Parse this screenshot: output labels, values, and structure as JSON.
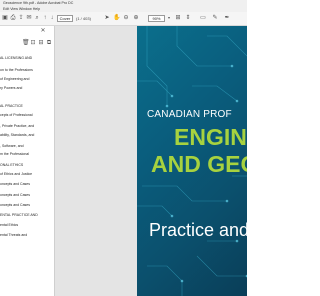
{
  "window": {
    "title": "Geoscience 9th.pdf - Adobe Acrobat Pro DC"
  },
  "menubar": {
    "text": "Edit  View  Window  Help"
  },
  "toolbar": {
    "page_input": "Cover",
    "page_count": "(1 / 403)",
    "zoom": "90%",
    "icons": [
      "save-icon",
      "print-icon",
      "upload-icon",
      "email-icon",
      "search-icon",
      "prev-page-icon",
      "next-page-icon",
      "select-icon",
      "hand-icon",
      "zoom-out-icon",
      "zoom-in-icon",
      "zoom-dropdown-icon",
      "fit-page-icon",
      "scroll-mode-icon",
      "comment-icon",
      "highlight-icon",
      "sign-icon"
    ]
  },
  "bookmarks_pane": {
    "items": [
      "AL LICENSING AND",
      "on to the Professions",
      "of Engineering and",
      "ry Powers and",
      "AL PRACTICE",
      "cepts of Professional",
      ", Private Practice, and",
      "ability, Standards, and",
      ", Software, and",
      "m the Professional",
      "ONAL ETHICS",
      "of Ethics and Justice",
      "oncepts and Cases",
      "oncepts and Cases",
      "oncepts and Cases",
      "ENTAL PRACTICE AND",
      "ental Ethics",
      "ental Threats and"
    ]
  },
  "cover": {
    "line1": "CANADIAN PROF",
    "line2": "ENGINE",
    "line3": "AND GEOSC",
    "line4": "Practice and",
    "colors": {
      "accent": "#a7d23f",
      "background": "#0b5f7e",
      "text": "#ffffff"
    }
  }
}
